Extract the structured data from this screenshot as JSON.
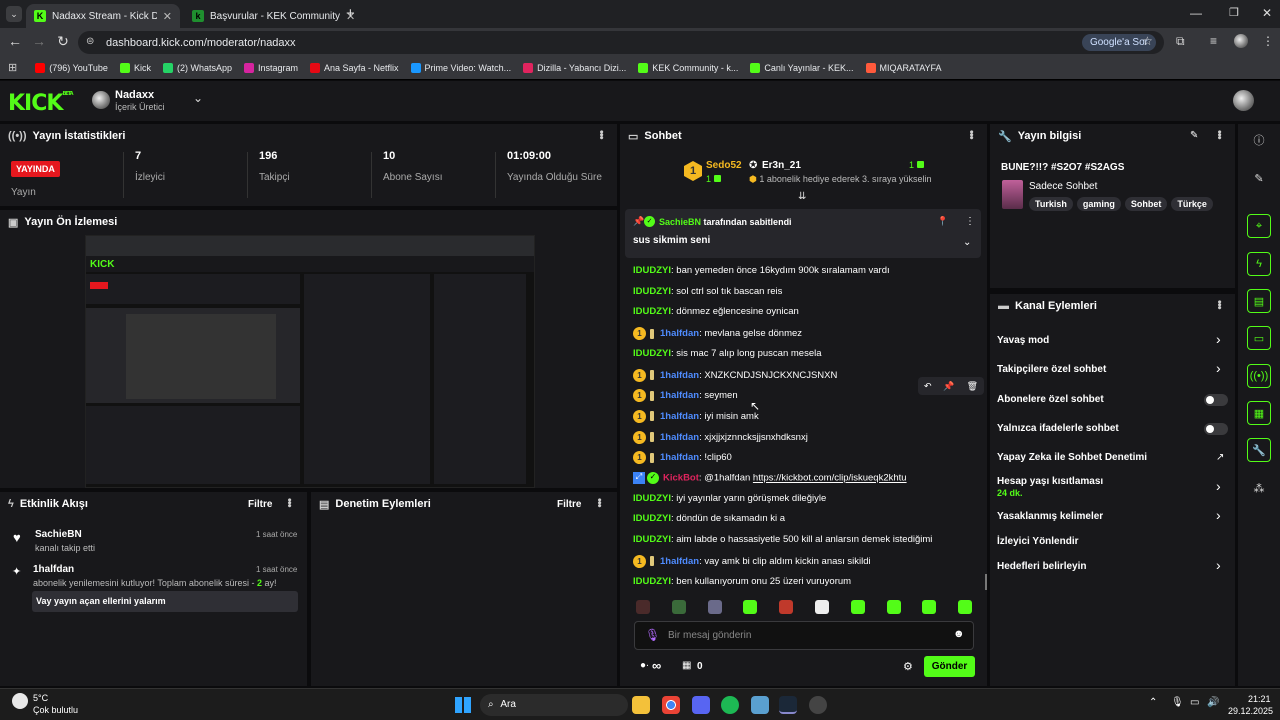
{
  "browser": {
    "tabs": [
      {
        "title": "Nadaxx Stream - Kick Dashboard"
      },
      {
        "title": "Başvurular - KEK Community"
      }
    ],
    "url": "dashboard.kick.com/moderator/nadaxx",
    "google_btn": "Google'a Sor",
    "bookmarks": [
      {
        "label": "(796) YouTube",
        "color": "#ff0000"
      },
      {
        "label": "Kick",
        "color": "#53fc18"
      },
      {
        "label": "(2) WhatsApp",
        "color": "#25d366"
      },
      {
        "label": "Instagram",
        "color": "#d6249f"
      },
      {
        "label": "Ana Sayfa - Netflix",
        "color": "#e50914"
      },
      {
        "label": "Prime Video: Watch...",
        "color": "#1a98ff"
      },
      {
        "label": "Dizilla - Yabancı Dizi...",
        "color": "#e0245e"
      },
      {
        "label": "KEK Community - k...",
        "color": "#53fc18"
      },
      {
        "label": "Canlı Yayınlar - KEK...",
        "color": "#53fc18"
      },
      {
        "label": "MIQARATAYFA",
        "color": "#ff5a3c"
      }
    ]
  },
  "header": {
    "logo": "KICK",
    "logo_beta": "BETA",
    "channel": "Nadaxx",
    "role": "İçerik Üretici"
  },
  "stats": {
    "title": "Yayın İstatistikleri",
    "live_badge": "YAYINDA",
    "live_label": "Yayın",
    "viewers": "7",
    "viewers_label": "İzleyici",
    "followers": "196",
    "followers_label": "Takipçi",
    "subs": "10",
    "subs_label": "Abone Sayısı",
    "uptime": "01:09:00",
    "uptime_label": "Yayında Olduğu Süre"
  },
  "preview": {
    "title": "Yayın Ön İzlemesi"
  },
  "activity": {
    "title": "Etkinlik Akışı",
    "filter": "Filtre",
    "items": [
      {
        "user": "SachieBN",
        "time": "1 saat önce",
        "text": "kanalı takip etti"
      },
      {
        "user": "1halfdan",
        "time": "1 saat önce",
        "text": "abonelik yenilemesini kutluyor! Toplam abonelik süresi - ",
        "count": "2",
        "suffix": " ay!",
        "msg": "Vay yayın açan ellerini yalarım"
      }
    ]
  },
  "moderation": {
    "title": "Denetim Eylemleri",
    "filter": "Filtre"
  },
  "chat": {
    "title": "Sohbet",
    "gifter": {
      "name": "Sedo52",
      "count": "1",
      "name2": "Er3n_21",
      "count2": "1",
      "text": "1 abonelik hediye ederek 3. sıraya yükselin"
    },
    "pinned": {
      "by": "SachieBN",
      "by_suffix": "tarafından sabitlendi",
      "text": "sus sikmim seni"
    },
    "messages": [
      {
        "user": "IDUDZYI",
        "color": "#53fc18",
        "badges": false,
        "text": "ban yemeden önce 16kydım 900k sıralamam vardı"
      },
      {
        "user": "IDUDZYI",
        "color": "#53fc18",
        "badges": false,
        "text": "sol ctrl sol tık bascan reis"
      },
      {
        "user": "IDUDZYI",
        "color": "#53fc18",
        "badges": false,
        "text": "dönmez eğlencesine oynican"
      },
      {
        "user": "1halfdan",
        "color": "#4f8cff",
        "badges": true,
        "text": "mevlana gelse dönmez"
      },
      {
        "user": "IDUDZYI",
        "color": "#53fc18",
        "badges": false,
        "text": "sis mac 7 alıp long puscan mesela"
      },
      {
        "user": "1halfdan",
        "color": "#4f8cff",
        "badges": true,
        "text": "XNZKCNDJSNJCKXNCJSNXN"
      },
      {
        "user": "1halfdan",
        "color": "#4f8cff",
        "badges": true,
        "text": "seymen"
      },
      {
        "user": "1halfdan",
        "color": "#4f8cff",
        "badges": true,
        "text": "iyi misin amk"
      },
      {
        "user": "1halfdan",
        "color": "#4f8cff",
        "badges": true,
        "text": "xjxjjxjznncksjjsnxhdksnxj"
      },
      {
        "user": "1halfdan",
        "color": "#4f8cff",
        "badges": true,
        "text": "!clip60"
      },
      {
        "user": "KickBot",
        "color": "#e0245e",
        "badges": false,
        "bot": true,
        "text": "@1halfdan ",
        "link": "https://kickbot.com/clip/iskueqk2khtu"
      },
      {
        "user": "IDUDZYI",
        "color": "#53fc18",
        "badges": false,
        "text": "iyi yayınlar yarın görüşmek dileğiyle"
      },
      {
        "user": "IDUDZYI",
        "color": "#53fc18",
        "badges": false,
        "text": "döndün de sıkamadın ki a"
      },
      {
        "user": "IDUDZYI",
        "color": "#53fc18",
        "badges": false,
        "text": "aim labde o hassasiyetle 500 kill al anlarsın demek istediğimi"
      },
      {
        "user": "1halfdan",
        "color": "#4f8cff",
        "badges": true,
        "text": "vay amk bi clip aldım kickin anası sikildi"
      },
      {
        "user": "IDUDZYI",
        "color": "#53fc18",
        "badges": false,
        "text": "ben kullanıyorum onu 25 üzeri vuruyorum"
      }
    ],
    "input_placeholder": "Bir mesaj gönderin",
    "infinity": "∞",
    "gift_count": "0",
    "send": "Gönder"
  },
  "stream_info": {
    "title": "Yayın bilgisi",
    "stream_title": "BUNE?!!? #S2O7 #S2AGS",
    "category": "Sadece Sohbet",
    "tags": [
      "Turkish",
      "gaming",
      "Sohbet",
      "Türkçe"
    ]
  },
  "actions": {
    "title": "Kanal Eylemleri",
    "slow": "Yavaş mod",
    "followers": "Takipçilere özel sohbet",
    "subs": "Abonelere özel sohbet",
    "emotes": "Yalnızca ifadelerle sohbet",
    "ai": "Yapay Zeka ile Sohbet Denetimi",
    "age": "Hesap yaşı kısıtlaması",
    "age_val": "24 dk.",
    "banned": "Yasaklanmış kelimeler",
    "redirect": "İzleyici Yönlendir",
    "targets": "Hedefleri belirleyin"
  },
  "taskbar": {
    "temp": "5°C",
    "weather": "Çok bulutlu",
    "search": "Ara",
    "time": "21:21",
    "date": "29.12.2025"
  }
}
